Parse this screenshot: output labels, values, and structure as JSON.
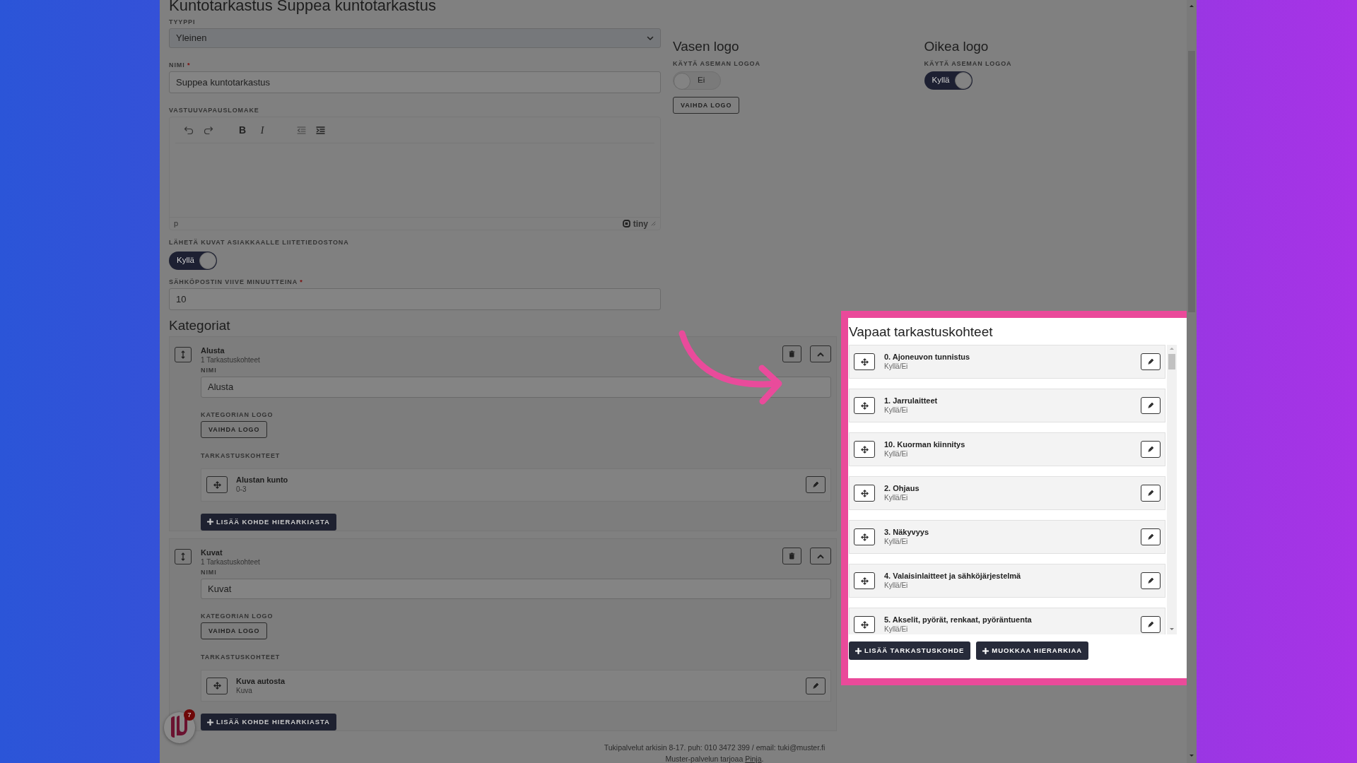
{
  "page_title": "Kuntotarkastus Suppea kuntotarkastus",
  "form": {
    "type": {
      "label": "TYYPPI",
      "value": "Yleinen"
    },
    "name": {
      "label": "NIMI",
      "required_mark": "*",
      "value": "Suppea kuntotarkastus"
    },
    "disclaimer": {
      "label": "VASTUUVAPAUSLOMAKE",
      "toolbar_glyphs": [
        "B",
        "I"
      ],
      "path": "p",
      "brand": "tiny"
    },
    "send_images": {
      "label": "LÄHETÄ KUVAT ASIAKKAALLE LIITETIEDOSTONA",
      "on": true,
      "text": "Kyllä"
    },
    "email_delay": {
      "label": "SÄHKÖPOSTIN VIIVE MINUUTTEINA",
      "required_mark": "*",
      "value": "10"
    }
  },
  "logos": [
    {
      "title": "Vasen logo",
      "toggle_label": "KÄYTÄ ASEMAN LOGOA",
      "on": false,
      "toggle_text": "Ei",
      "button": "VAIHDA LOGO"
    },
    {
      "title": "Oikea logo",
      "toggle_label": "KÄYTÄ ASEMAN LOGOA",
      "on": true,
      "toggle_text": "Kyllä"
    }
  ],
  "categories": {
    "title": "Kategoriat",
    "items": [
      {
        "name": "Alusta",
        "count": "1 Tarkastuskohteet",
        "name_label": "NIMI",
        "name_value": "Alusta",
        "logo_label": "KATEGORIAN LOGO",
        "logo_button": "VAIHDA LOGO",
        "items_label": "TARKASTUSKOHTEET",
        "items": [
          {
            "title": "Alustan kunto",
            "subtitle": "0-3"
          }
        ],
        "add_button": "LISÄÄ KOHDE HIERARKIASTA"
      },
      {
        "name": "Kuvat",
        "count": "1 Tarkastuskohteet",
        "name_label": "NIMI",
        "name_value": "Kuvat",
        "logo_label": "KATEGORIAN LOGO",
        "logo_button": "VAIHDA LOGO",
        "items_label": "TARKASTUSKOHTEET",
        "items": [
          {
            "title": "Kuva autosta",
            "subtitle": "Kuva"
          }
        ],
        "add_button": "LISÄÄ KOHDE HIERARKIASTA"
      }
    ]
  },
  "free_items": {
    "title": "Vapaat tarkastuskohteet",
    "items": [
      {
        "title": "0. Ajoneuvon tunnistus",
        "subtitle": "Kyllä/Ei"
      },
      {
        "title": "1. Jarrulaitteet",
        "subtitle": "Kyllä/Ei"
      },
      {
        "title": "10. Kuorman kiinnitys",
        "subtitle": "Kyllä/Ei"
      },
      {
        "title": "2. Ohjaus",
        "subtitle": "Kyllä/Ei"
      },
      {
        "title": "3. Näkyvyys",
        "subtitle": "Kyllä/Ei"
      },
      {
        "title": "4. Valaisinlaitteet ja sähköjärjestelmä",
        "subtitle": "Kyllä/Ei"
      },
      {
        "title": "5. Akselit, pyörät, renkaat, pyöräntuenta",
        "subtitle": "Kyllä/Ei"
      }
    ],
    "buttons": [
      "LISÄÄ TARKASTUSKOHDE",
      "MUOKKAA HIERARKIAA"
    ]
  },
  "footer": {
    "support": "Tukipalvelut arkisin 8-17. puh: 010 3472 399 / email: tuki@muster.fi",
    "credit": "Muster-palvelun tarjoaa ",
    "link": "Pinja",
    "credit_end": "."
  },
  "launcher": {
    "badge": "7"
  }
}
